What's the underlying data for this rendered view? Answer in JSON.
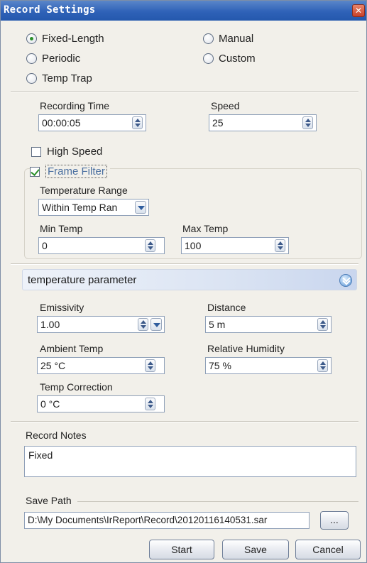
{
  "window": {
    "title": "Record Settings",
    "close_glyph": "✕"
  },
  "mode": {
    "options": [
      {
        "label": "Fixed-Length",
        "selected": true
      },
      {
        "label": "Manual",
        "selected": false
      },
      {
        "label": "Periodic",
        "selected": false
      },
      {
        "label": "Custom",
        "selected": false
      },
      {
        "label": "Temp Trap",
        "selected": false
      }
    ]
  },
  "recording": {
    "time_label": "Recording Time",
    "time_value": "00:00:05",
    "speed_label": "Speed",
    "speed_value": "25",
    "high_speed_label": "High Speed",
    "high_speed_checked": false
  },
  "frame_filter": {
    "label": "Frame Filter",
    "checked": true,
    "range_label": "Temperature Range",
    "range_value": "Within Temp Ran",
    "min_label": "Min Temp",
    "min_value": "0",
    "max_label": "Max Temp",
    "max_value": "100"
  },
  "temperature_parameter": {
    "section_label": "temperature parameter",
    "emissivity_label": "Emissivity",
    "emissivity_value": "1.00",
    "distance_label": "Distance",
    "distance_value": "5 m",
    "ambient_label": "Ambient Temp",
    "ambient_value": "25 °C",
    "humidity_label": "Relative Humidity",
    "humidity_value": "75 %",
    "correction_label": "Temp Correction",
    "correction_value": "0 °C"
  },
  "notes": {
    "label": "Record Notes",
    "value": "Fixed"
  },
  "save_path": {
    "label": "Save Path",
    "value": "D:\\My Documents\\IrReport\\Record\\20120116140531.sar",
    "browse_label": "..."
  },
  "buttons": {
    "start": "Start",
    "save": "Save",
    "cancel": "Cancel"
  },
  "colors": {
    "title_bar": "#2f62b8",
    "check_mark": "#2a8f2a",
    "section_bar": "#dbe4f3"
  }
}
